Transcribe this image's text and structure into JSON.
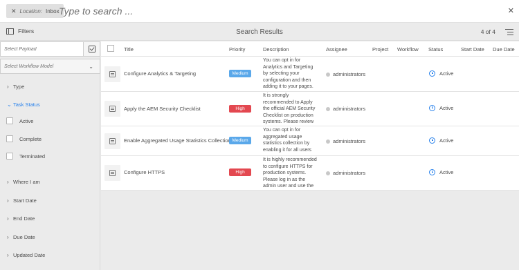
{
  "search": {
    "chip_prefix": "Location:",
    "chip_value": "Inbox",
    "placeholder": "Type to search ..."
  },
  "header": {
    "filters_label": "Filters",
    "title": "Search Results",
    "count": "4 of 4"
  },
  "filters": {
    "payload_placeholder": "Select Payload",
    "workflow_model_placeholder": "Select Workflow Model",
    "sections": {
      "type": "Type",
      "task_status": "Task Status",
      "where_i_am": "Where I am",
      "start_date": "Start Date",
      "end_date": "End Date",
      "due_date": "Due Date",
      "updated_date": "Updated Date"
    },
    "status_options": [
      "Active",
      "Complete",
      "Terminated"
    ]
  },
  "table": {
    "columns": {
      "title": "Title",
      "priority": "Priority",
      "description": "Description",
      "assignee": "Assignee",
      "project": "Project",
      "workflow": "Workflow",
      "status": "Status",
      "start_date": "Start Date",
      "due_date": "Due Date"
    },
    "rows": [
      {
        "title": "Configure Analytics & Targeting",
        "priority": "Medium",
        "description": "You can opt in for Analytics and Targeting by selecting your configuration and then adding it to your pages.",
        "assignee": "administrators",
        "status": "Active"
      },
      {
        "title": "Apply the AEM Security Checklist",
        "priority": "High",
        "description": "It is strongly recommended to Apply the official AEM Security Checklist on production systems. Please review",
        "assignee": "administrators",
        "status": "Active"
      },
      {
        "title": "Enable Aggregated Usage Statistics Collection",
        "priority": "Medium",
        "description": "You can opt in for aggregated usage statistics collection by enabling it for all users",
        "assignee": "administrators",
        "status": "Active"
      },
      {
        "title": "Configure HTTPS",
        "priority": "High",
        "description": "It is highly recommended to configure HTTPS for production systems. Please log in as the admin user and use the",
        "assignee": "administrators",
        "status": "Active"
      }
    ]
  },
  "colors": {
    "accent": "#2680eb",
    "medium": "#5aa8ea",
    "high": "#e34850"
  }
}
